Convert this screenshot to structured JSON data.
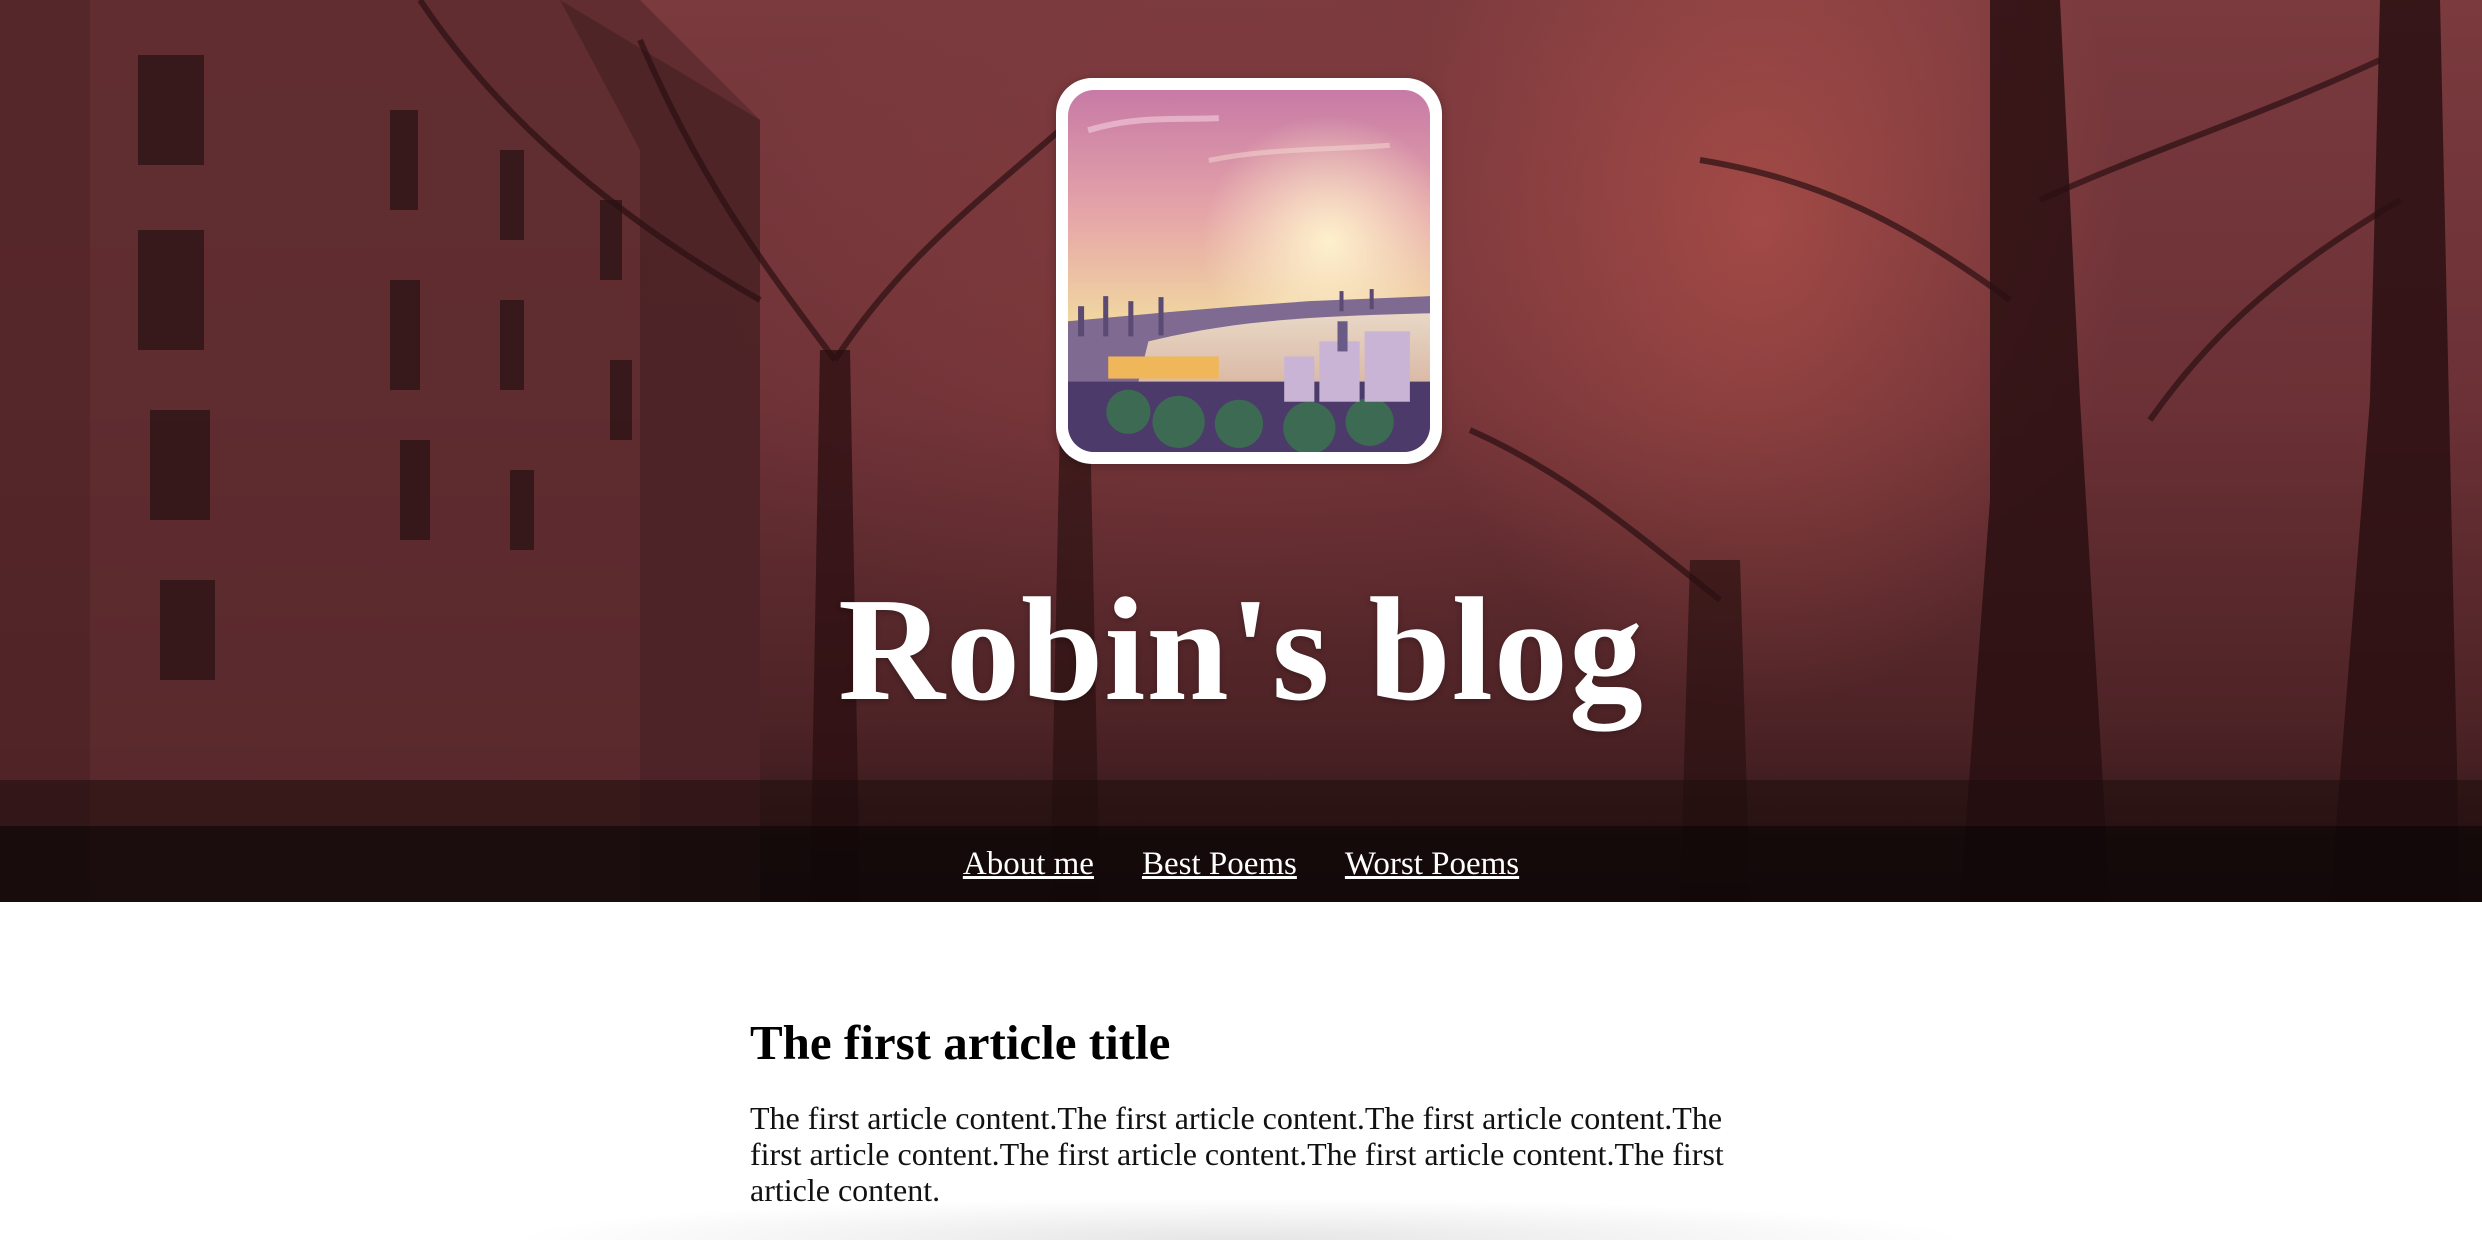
{
  "site": {
    "title": "Robin's blog"
  },
  "nav": {
    "items": [
      {
        "label": "About me"
      },
      {
        "label": "Best Poems"
      },
      {
        "label": "Worst Poems"
      }
    ]
  },
  "article": {
    "title": "The first article title",
    "content": "The first article content.The first article content.The first article content.The first article content.The first article content.The first article content.The first article content."
  },
  "colors": {
    "nav_background": "#0a0606",
    "frame": "#ffffff",
    "hero_tint": "#7a3a3e"
  }
}
